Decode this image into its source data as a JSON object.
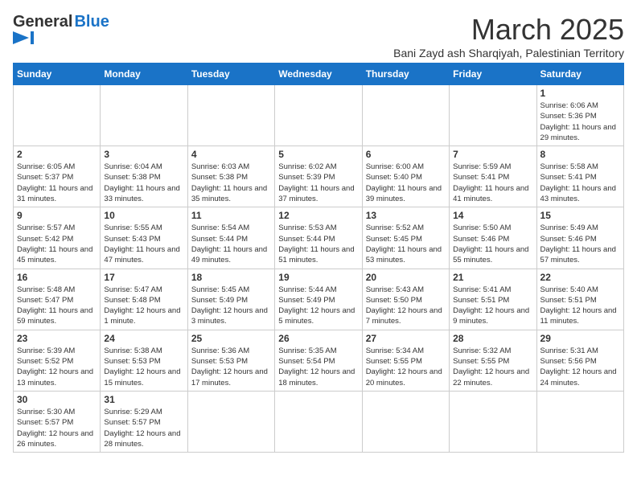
{
  "header": {
    "logo_general": "General",
    "logo_blue": "Blue",
    "month": "March 2025",
    "location": "Bani Zayd ash Sharqiyah, Palestinian Territory"
  },
  "days_of_week": [
    "Sunday",
    "Monday",
    "Tuesday",
    "Wednesday",
    "Thursday",
    "Friday",
    "Saturday"
  ],
  "weeks": [
    [
      {
        "day": "",
        "info": ""
      },
      {
        "day": "",
        "info": ""
      },
      {
        "day": "",
        "info": ""
      },
      {
        "day": "",
        "info": ""
      },
      {
        "day": "",
        "info": ""
      },
      {
        "day": "",
        "info": ""
      },
      {
        "day": "1",
        "info": "Sunrise: 6:06 AM\nSunset: 5:36 PM\nDaylight: 11 hours and 29 minutes."
      }
    ],
    [
      {
        "day": "2",
        "info": "Sunrise: 6:05 AM\nSunset: 5:37 PM\nDaylight: 11 hours and 31 minutes."
      },
      {
        "day": "3",
        "info": "Sunrise: 6:04 AM\nSunset: 5:38 PM\nDaylight: 11 hours and 33 minutes."
      },
      {
        "day": "4",
        "info": "Sunrise: 6:03 AM\nSunset: 5:38 PM\nDaylight: 11 hours and 35 minutes."
      },
      {
        "day": "5",
        "info": "Sunrise: 6:02 AM\nSunset: 5:39 PM\nDaylight: 11 hours and 37 minutes."
      },
      {
        "day": "6",
        "info": "Sunrise: 6:00 AM\nSunset: 5:40 PM\nDaylight: 11 hours and 39 minutes."
      },
      {
        "day": "7",
        "info": "Sunrise: 5:59 AM\nSunset: 5:41 PM\nDaylight: 11 hours and 41 minutes."
      },
      {
        "day": "8",
        "info": "Sunrise: 5:58 AM\nSunset: 5:41 PM\nDaylight: 11 hours and 43 minutes."
      }
    ],
    [
      {
        "day": "9",
        "info": "Sunrise: 5:57 AM\nSunset: 5:42 PM\nDaylight: 11 hours and 45 minutes."
      },
      {
        "day": "10",
        "info": "Sunrise: 5:55 AM\nSunset: 5:43 PM\nDaylight: 11 hours and 47 minutes."
      },
      {
        "day": "11",
        "info": "Sunrise: 5:54 AM\nSunset: 5:44 PM\nDaylight: 11 hours and 49 minutes."
      },
      {
        "day": "12",
        "info": "Sunrise: 5:53 AM\nSunset: 5:44 PM\nDaylight: 11 hours and 51 minutes."
      },
      {
        "day": "13",
        "info": "Sunrise: 5:52 AM\nSunset: 5:45 PM\nDaylight: 11 hours and 53 minutes."
      },
      {
        "day": "14",
        "info": "Sunrise: 5:50 AM\nSunset: 5:46 PM\nDaylight: 11 hours and 55 minutes."
      },
      {
        "day": "15",
        "info": "Sunrise: 5:49 AM\nSunset: 5:46 PM\nDaylight: 11 hours and 57 minutes."
      }
    ],
    [
      {
        "day": "16",
        "info": "Sunrise: 5:48 AM\nSunset: 5:47 PM\nDaylight: 11 hours and 59 minutes."
      },
      {
        "day": "17",
        "info": "Sunrise: 5:47 AM\nSunset: 5:48 PM\nDaylight: 12 hours and 1 minute."
      },
      {
        "day": "18",
        "info": "Sunrise: 5:45 AM\nSunset: 5:49 PM\nDaylight: 12 hours and 3 minutes."
      },
      {
        "day": "19",
        "info": "Sunrise: 5:44 AM\nSunset: 5:49 PM\nDaylight: 12 hours and 5 minutes."
      },
      {
        "day": "20",
        "info": "Sunrise: 5:43 AM\nSunset: 5:50 PM\nDaylight: 12 hours and 7 minutes."
      },
      {
        "day": "21",
        "info": "Sunrise: 5:41 AM\nSunset: 5:51 PM\nDaylight: 12 hours and 9 minutes."
      },
      {
        "day": "22",
        "info": "Sunrise: 5:40 AM\nSunset: 5:51 PM\nDaylight: 12 hours and 11 minutes."
      }
    ],
    [
      {
        "day": "23",
        "info": "Sunrise: 5:39 AM\nSunset: 5:52 PM\nDaylight: 12 hours and 13 minutes."
      },
      {
        "day": "24",
        "info": "Sunrise: 5:38 AM\nSunset: 5:53 PM\nDaylight: 12 hours and 15 minutes."
      },
      {
        "day": "25",
        "info": "Sunrise: 5:36 AM\nSunset: 5:53 PM\nDaylight: 12 hours and 17 minutes."
      },
      {
        "day": "26",
        "info": "Sunrise: 5:35 AM\nSunset: 5:54 PM\nDaylight: 12 hours and 18 minutes."
      },
      {
        "day": "27",
        "info": "Sunrise: 5:34 AM\nSunset: 5:55 PM\nDaylight: 12 hours and 20 minutes."
      },
      {
        "day": "28",
        "info": "Sunrise: 5:32 AM\nSunset: 5:55 PM\nDaylight: 12 hours and 22 minutes."
      },
      {
        "day": "29",
        "info": "Sunrise: 5:31 AM\nSunset: 5:56 PM\nDaylight: 12 hours and 24 minutes."
      }
    ],
    [
      {
        "day": "30",
        "info": "Sunrise: 5:30 AM\nSunset: 5:57 PM\nDaylight: 12 hours and 26 minutes."
      },
      {
        "day": "31",
        "info": "Sunrise: 5:29 AM\nSunset: 5:57 PM\nDaylight: 12 hours and 28 minutes."
      },
      {
        "day": "",
        "info": ""
      },
      {
        "day": "",
        "info": ""
      },
      {
        "day": "",
        "info": ""
      },
      {
        "day": "",
        "info": ""
      },
      {
        "day": "",
        "info": ""
      }
    ]
  ]
}
